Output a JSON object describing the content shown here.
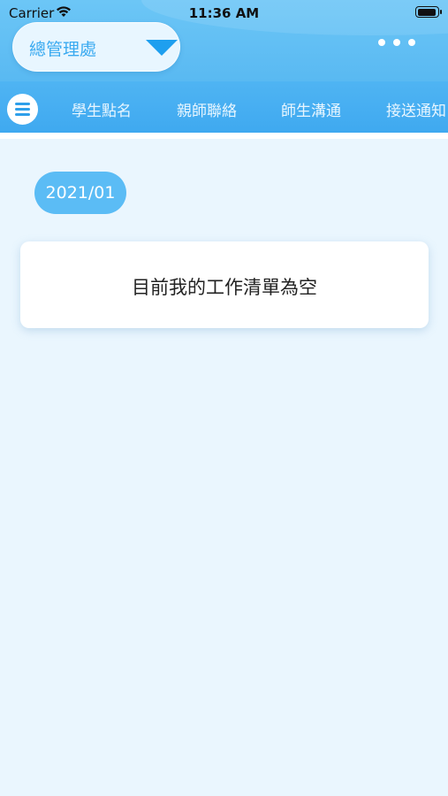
{
  "status_bar": {
    "carrier": "Carrier",
    "time": "11:36 AM"
  },
  "header": {
    "org_select_value": "總管理處",
    "more_icon": "ellipsis-icon"
  },
  "nav": {
    "tabs": [
      {
        "label": "學生點名"
      },
      {
        "label": "親師聯絡"
      },
      {
        "label": "師生溝通"
      },
      {
        "label": "接送通知"
      }
    ]
  },
  "main": {
    "date_label": "2021/01",
    "empty_message": "目前我的工作清單為空"
  },
  "colors": {
    "header_bg": "#59b9f2",
    "nav_bg": "#3fa9f0",
    "accent": "#1e9fef",
    "page_bg": "#eaf6fe"
  }
}
